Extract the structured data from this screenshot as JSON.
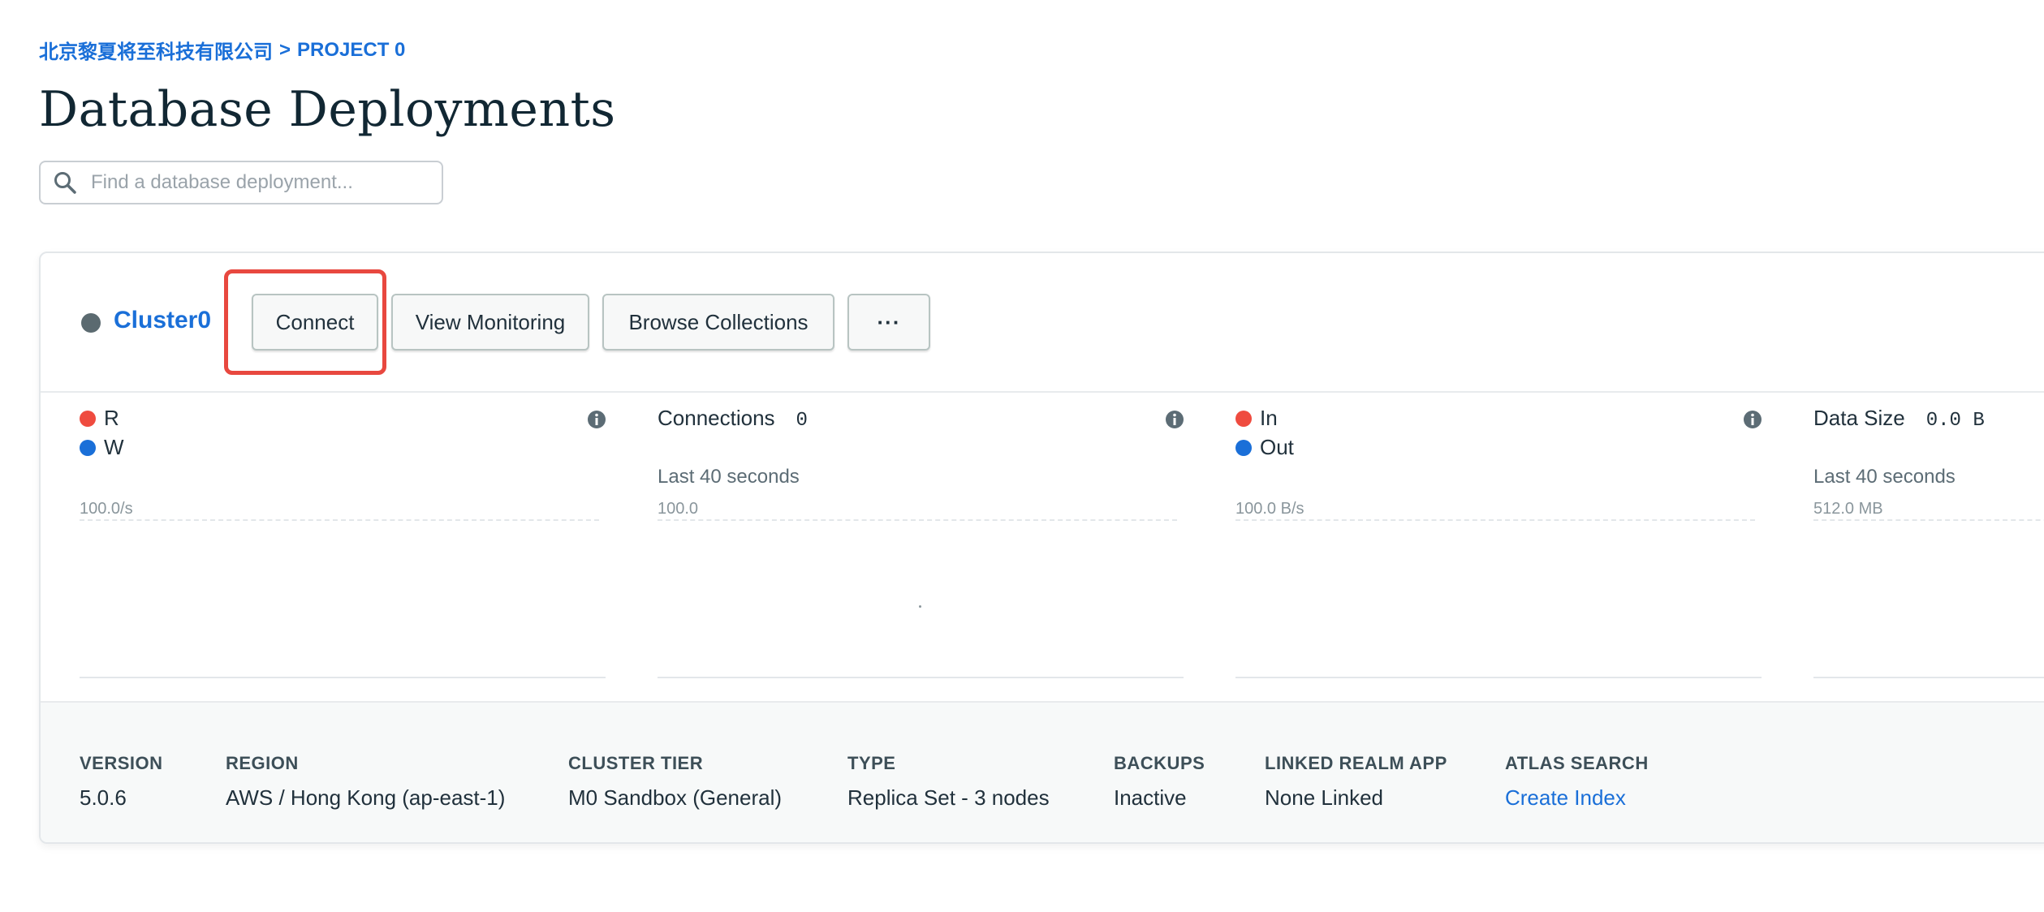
{
  "breadcrumb": {
    "org": "北京黎夏将至科技有限公司",
    "separator": ">",
    "project": "PROJECT 0"
  },
  "page_title": "Database Deployments",
  "search": {
    "placeholder": "Find a database deployment...",
    "value": ""
  },
  "cluster": {
    "name": "Cluster0",
    "status_color": "#5b6a70",
    "buttons": {
      "connect": "Connect",
      "view_monitoring": "View Monitoring",
      "browse_collections": "Browse Collections",
      "more": "···"
    }
  },
  "metrics": {
    "ops": {
      "legend_r": "R",
      "legend_w": "W",
      "axis_max": "100.0/s",
      "color_r": "#ef4b3f",
      "color_w": "#1a6fd8"
    },
    "connections": {
      "title": "Connections",
      "value": "0",
      "subtitle": "Last 40 seconds",
      "axis_max": "100.0"
    },
    "network": {
      "legend_in": "In",
      "legend_out": "Out",
      "axis_max": "100.0 B/s",
      "color_in": "#ef4b3f",
      "color_out": "#1a6fd8"
    },
    "data_size": {
      "title": "Data Size",
      "value": "0.0 B",
      "subtitle": "Last 40 seconds",
      "axis_max": "512.0 MB"
    }
  },
  "details": {
    "version": {
      "label": "VERSION",
      "value": "5.0.6"
    },
    "region": {
      "label": "REGION",
      "value": "AWS / Hong Kong (ap-east-1)"
    },
    "cluster_tier": {
      "label": "CLUSTER TIER",
      "value": "M0 Sandbox (General)"
    },
    "type": {
      "label": "TYPE",
      "value": "Replica Set - 3 nodes"
    },
    "backups": {
      "label": "BACKUPS",
      "value": "Inactive"
    },
    "linked_realm_app": {
      "label": "LINKED REALM APP",
      "value": "None Linked"
    },
    "atlas_search": {
      "label": "ATLAS SEARCH",
      "value": "Create Index"
    }
  },
  "colors": {
    "link": "#1a6fd8",
    "highlight": "#e8483f",
    "title": "#112733"
  }
}
